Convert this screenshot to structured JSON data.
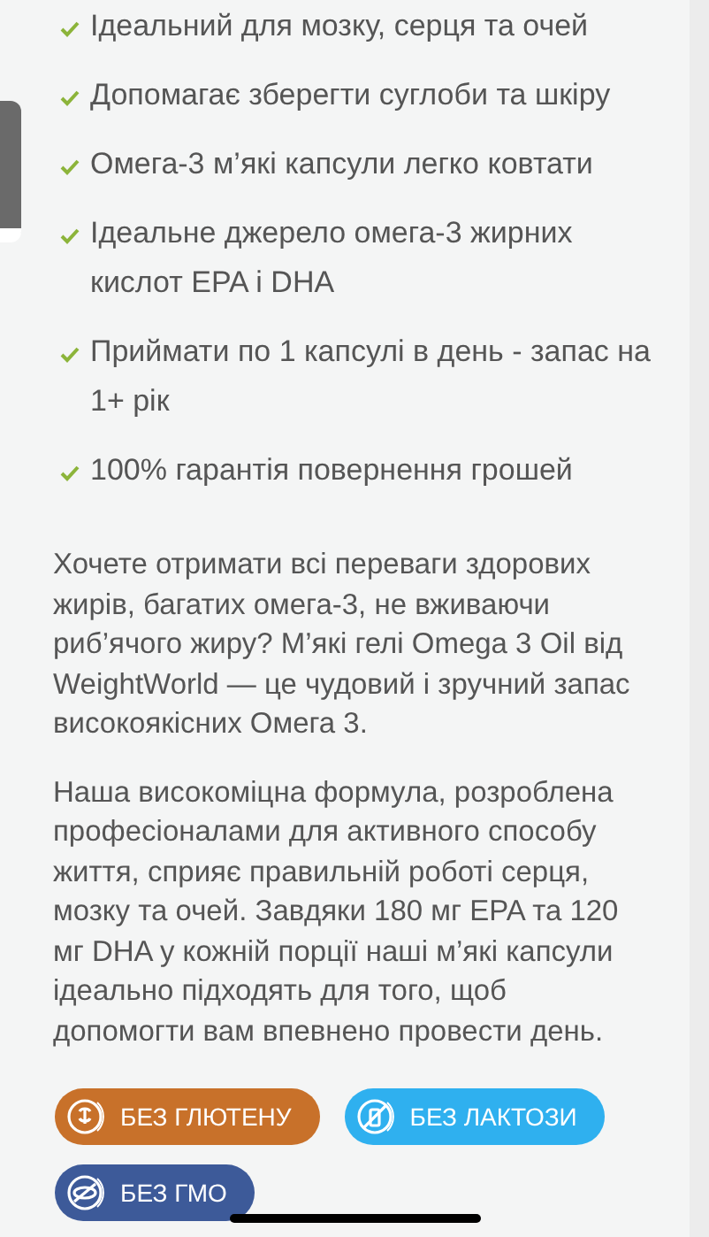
{
  "benefits": [
    {
      "text": "Ідеальний для мозку, серця та очей"
    },
    {
      "text": "Допомагає зберегти суглоби та шкіру"
    },
    {
      "text": "Омега-3 м’які капсули легко ковтати"
    },
    {
      "text": "Ідеальне джерело омега-3 жирних кислот EPA і DHA"
    },
    {
      "text": "Приймати по 1 капсулі в день - запас на 1+ рік"
    },
    {
      "text": "100% гарантія повернення грошей"
    }
  ],
  "paragraphs": [
    "Хочете отримати всі переваги здорових жирів, багатих омега-3, не вживаючи риб’ячого жиру? М’які гелі Omega 3 Oil від WeightWorld — це чудовий і зручний запас високоякісних Омега 3.",
    "Наша високоміцна формула, розроблена професіоналами для активного способу життя, сприяє правильній роботі серця, мозку та очей. Завдяки 180 мг EPA та 120 мг DHA у кожній порції наші м’які капсули ідеально підходять для того, щоб допомогти вам впевнено провести день."
  ],
  "badges": [
    {
      "label": "БЕЗ ГЛЮТЕНУ",
      "kind": "gluten",
      "color": "#c8712a"
    },
    {
      "label": "БЕЗ ЛАКТОЗИ",
      "kind": "lactose",
      "color": "#2fb0ef"
    },
    {
      "label": "БЕЗ ГМО",
      "kind": "gmo",
      "color": "#3d5a99"
    }
  ]
}
